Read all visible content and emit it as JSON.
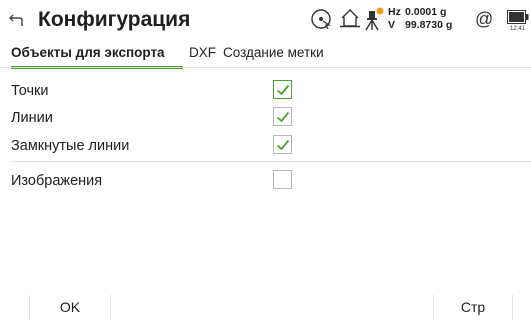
{
  "header": {
    "title": "Конфигурация",
    "hz_label": "Hz",
    "hz_value": "0.0001 g",
    "v_label": "V",
    "v_value": "99.8730 g",
    "at_symbol": "@",
    "time": "12:41"
  },
  "tabs": [
    {
      "label": "Объекты для экспорта",
      "active": true
    },
    {
      "label": "DXF",
      "active": false
    },
    {
      "label": "Создание метки",
      "active": false
    }
  ],
  "rows": [
    {
      "label": "Точки",
      "checked": true,
      "focused": true
    },
    {
      "label": "Линии",
      "checked": true,
      "focused": false
    },
    {
      "label": "Замкнутые линии",
      "checked": true,
      "focused": false
    },
    {
      "label": "Изображения",
      "checked": false,
      "focused": false
    }
  ],
  "footer": {
    "ok_label": "OK",
    "page_label": "Стр"
  },
  "colors": {
    "accent": "#4ba32d",
    "text": "#1f1f1f",
    "divider": "#e3e3e3"
  }
}
